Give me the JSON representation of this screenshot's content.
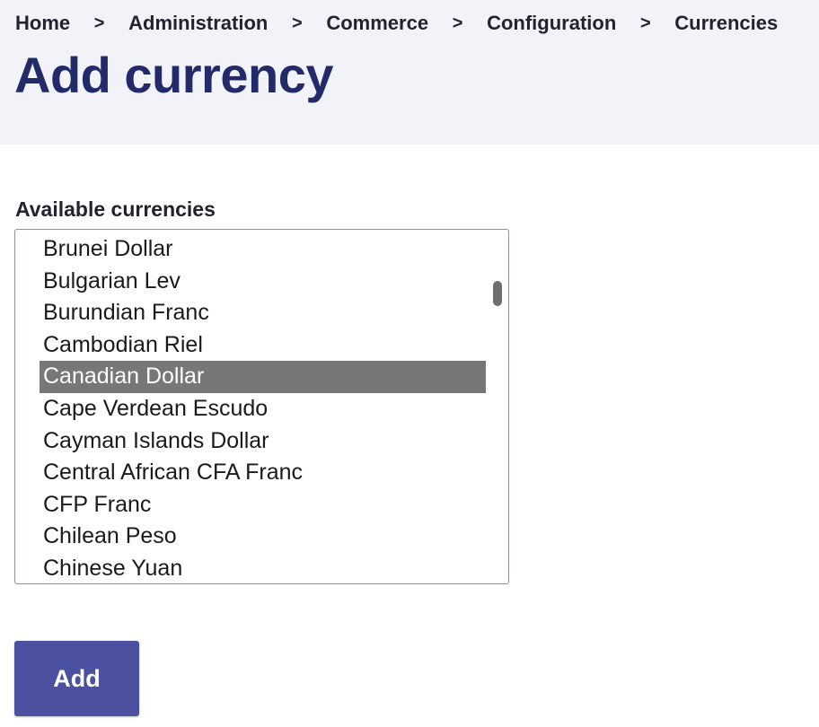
{
  "breadcrumb": {
    "items": [
      "Home",
      "Administration",
      "Commerce",
      "Configuration",
      "Currencies"
    ],
    "separator": ">"
  },
  "page": {
    "title": "Add currency"
  },
  "currency_field": {
    "label": "Available currencies",
    "options": [
      "Brunei Dollar",
      "Bulgarian Lev",
      "Burundian Franc",
      "Cambodian Riel",
      "Canadian Dollar",
      "Cape Verdean Escudo",
      "Cayman Islands Dollar",
      "Central African CFA Franc",
      "CFP Franc",
      "Chilean Peso",
      "Chinese Yuan"
    ],
    "selected": "Canadian Dollar"
  },
  "actions": {
    "add_label": "Add"
  },
  "colors": {
    "header_bg": "#f2f3f8",
    "title": "#232a6a",
    "button": "#4c50a0",
    "selected_bg": "#777777"
  }
}
